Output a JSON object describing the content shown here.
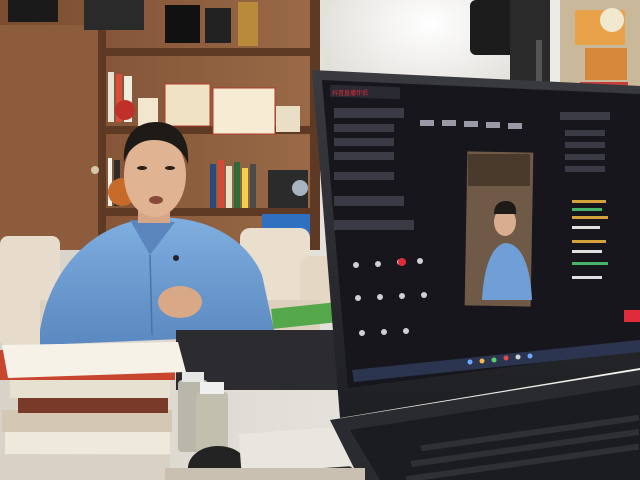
{
  "scene": {
    "laptop_screen": {
      "app_title": "",
      "status_bar_present": true
    },
    "colors": {
      "shirt": "#6f9fd6",
      "wood_shelf": "#8a5a3a",
      "screen_bg": "#1b1b22",
      "accent_red": "#e02b3a",
      "window_glow": "#f4f4f2"
    }
  }
}
